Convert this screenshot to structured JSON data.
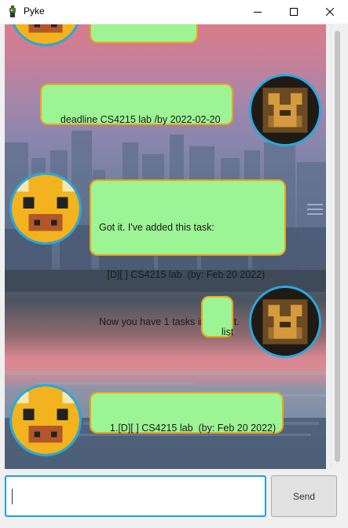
{
  "window": {
    "title": "Pyke",
    "controls": [
      "minimize-icon",
      "maximize-icon",
      "close-icon"
    ]
  },
  "chat": {
    "messages": [
      {
        "sender": "bot",
        "text": "",
        "partial": true
      },
      {
        "sender": "user",
        "text": "deadline CS4215 lab /by 2022-02-20"
      },
      {
        "sender": "bot",
        "lines": [
          "Got it. I've added this task:",
          "   [D][ ] CS4215 lab  (by: Feb 20 2022)",
          "Now you have 1 tasks in the list."
        ]
      },
      {
        "sender": "user",
        "text": "list"
      },
      {
        "sender": "bot",
        "text": "1.[D][ ] CS4215 lab  (by: Feb 20 2022)"
      }
    ]
  },
  "input": {
    "value": "",
    "send_label": "Send"
  },
  "colors": {
    "bubble_fill": "#9cf495",
    "bubble_border": "#f0a21a",
    "avatar_ring": "#27a9df",
    "input_focus": "#1ea1dc"
  }
}
